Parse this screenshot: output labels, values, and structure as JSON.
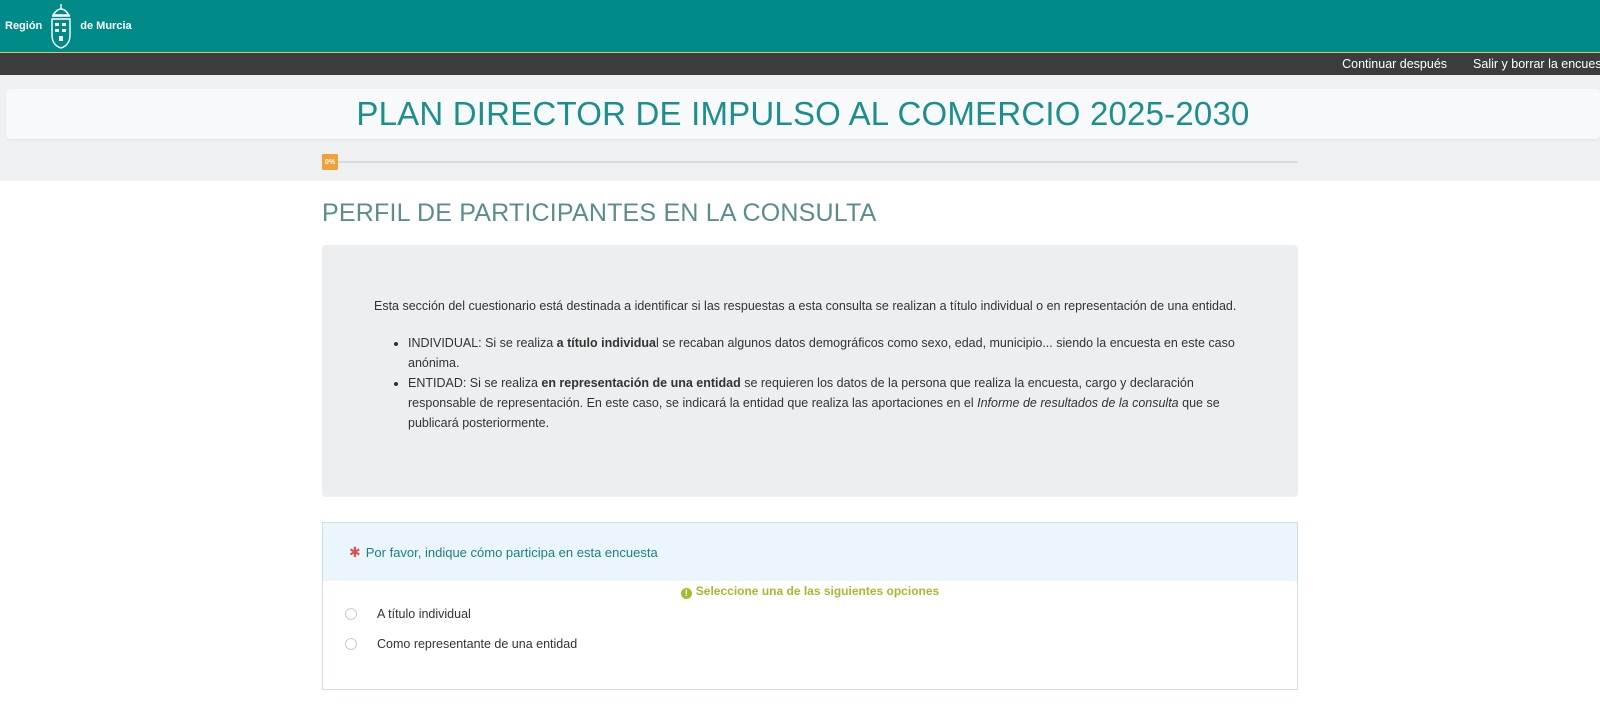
{
  "brand": {
    "left_text": "Región",
    "right_text": "de Murcia"
  },
  "nav": {
    "continue_later": "Continuar después",
    "exit_and_clear": "Salir y borrar la encuesta"
  },
  "survey": {
    "title": "PLAN DIRECTOR DE IMPULSO AL COMERCIO 2025-2030",
    "progress_label": "0%",
    "progress_value": 0
  },
  "group": {
    "title": "PERFIL DE PARTICIPANTES EN LA CONSULTA",
    "intro": "Esta sección del cuestionario está destinada a identificar si las respuestas a esta consulta se realizan a título individual o en representación de una entidad.",
    "bullet1_a": "INDIVIDUAL: Si se realiza ",
    "bullet1_b": "a título individua",
    "bullet1_c": "l se recaban algunos datos demográficos como sexo, edad, municipio... siendo la encuesta en este caso anónima.",
    "bullet2_a": "ENTIDAD: Si se realiza ",
    "bullet2_b": "en representación de una entidad",
    "bullet2_c": " se requieren los datos de la persona que realiza la encuesta, cargo y declaración responsable de representación. En este caso, se indicará la entidad que realiza las aportaciones en el ",
    "bullet2_d": "Informe de resultados de la consulta",
    "bullet2_e": " que se publicará posteriormente."
  },
  "question": {
    "required_mark": "✱",
    "text": "Por favor, indique cómo participa en esta encuesta",
    "help_icon": "!",
    "help": "Seleccione una de las siguientes opciones",
    "options": [
      "A título individual",
      "Como representante de una entidad"
    ]
  },
  "colors": {
    "brand_teal": "#008a88",
    "title_teal": "#1c8f8c",
    "progress_orange": "#f0a13a",
    "help_green": "#a7b92e"
  }
}
